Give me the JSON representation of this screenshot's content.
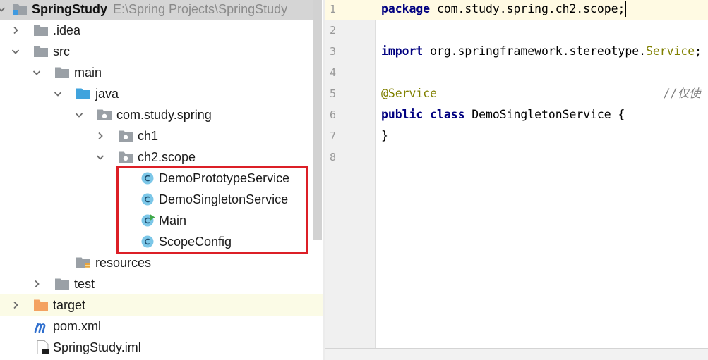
{
  "project_tree": {
    "root": {
      "name": "SpringStudy",
      "path": "E:\\Spring Projects\\SpringStudy",
      "icon": "module-folder-icon",
      "chevron": "chevron-down-icon",
      "selected": true
    },
    "items": [
      {
        "label": ".idea",
        "icon": "folder-icon",
        "chevron": "chevron-right-icon"
      },
      {
        "label": "src",
        "icon": "folder-icon",
        "chevron": "chevron-down-icon"
      },
      {
        "label": "main",
        "icon": "folder-icon",
        "chevron": "chevron-down-icon"
      },
      {
        "label": "java",
        "icon": "source-folder-icon",
        "chevron": "chevron-down-icon"
      },
      {
        "label": "com.study.spring",
        "icon": "package-icon",
        "chevron": "chevron-down-icon"
      },
      {
        "label": "ch1",
        "icon": "package-icon",
        "chevron": "chevron-right-icon"
      },
      {
        "label": "ch2.scope",
        "icon": "package-icon",
        "chevron": "chevron-down-icon"
      },
      {
        "label": "DemoPrototypeService",
        "icon": "java-class-icon"
      },
      {
        "label": "DemoSingletonService",
        "icon": "java-class-icon"
      },
      {
        "label": "Main",
        "icon": "java-main-class-icon"
      },
      {
        "label": "ScopeConfig",
        "icon": "java-class-icon"
      },
      {
        "label": "resources",
        "icon": "resources-folder-icon"
      },
      {
        "label": "test",
        "icon": "folder-icon",
        "chevron": "chevron-right-icon"
      },
      {
        "label": "target",
        "icon": "excluded-folder-icon",
        "chevron": "chevron-right-icon"
      },
      {
        "label": "pom.xml",
        "icon": "maven-pom-icon"
      },
      {
        "label": "SpringStudy.iml",
        "icon": "module-file-icon"
      }
    ]
  },
  "editor": {
    "line_numbers": [
      "1",
      "2",
      "3",
      "4",
      "5",
      "6",
      "7",
      "8"
    ],
    "lines": [
      [
        "package",
        " com.study.spring.ch2.scope;"
      ],
      [],
      [
        "import",
        " org.springframework.stereotype.",
        "Service",
        ";"
      ],
      [],
      [
        "@Service",
        "//仅使"
      ],
      [
        "public",
        " ",
        "class",
        " DemoSingletonService {"
      ],
      [
        "}"
      ],
      []
    ]
  },
  "colors": {
    "keyword": "#000080",
    "annotation": "#808000",
    "comment": "#808080",
    "line_number": "#999999",
    "current_line": "#fffae3",
    "tree_selection": "#d5d5d5",
    "excluded_row": "#fbfbe6",
    "highlight_box": "#dc1f26",
    "source_folder": "#40a3dd",
    "excluded_folder": "#f4a261"
  }
}
